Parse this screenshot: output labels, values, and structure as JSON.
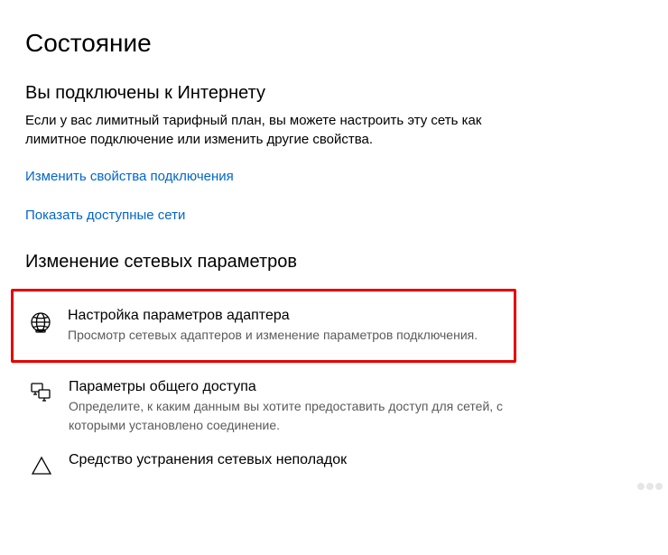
{
  "page": {
    "title": "Состояние"
  },
  "status": {
    "heading": "Вы подключены к Интернету",
    "description": "Если у вас лимитный тарифный план, вы можете настроить эту сеть как лимитное подключение или изменить другие свойства."
  },
  "links": {
    "change_connection_props": "Изменить свойства подключения",
    "show_available_networks": "Показать доступные сети"
  },
  "section": {
    "heading": "Изменение сетевых параметров"
  },
  "options": {
    "adapter": {
      "title": "Настройка параметров адаптера",
      "desc": "Просмотр сетевых адаптеров и изменение параметров подключения."
    },
    "sharing": {
      "title": "Параметры общего доступа",
      "desc": "Определите, к каким данным вы хотите предоставить доступ для сетей, с которыми установлено соединение."
    },
    "troubleshoot": {
      "title": "Средство устранения сетевых неполадок"
    }
  }
}
